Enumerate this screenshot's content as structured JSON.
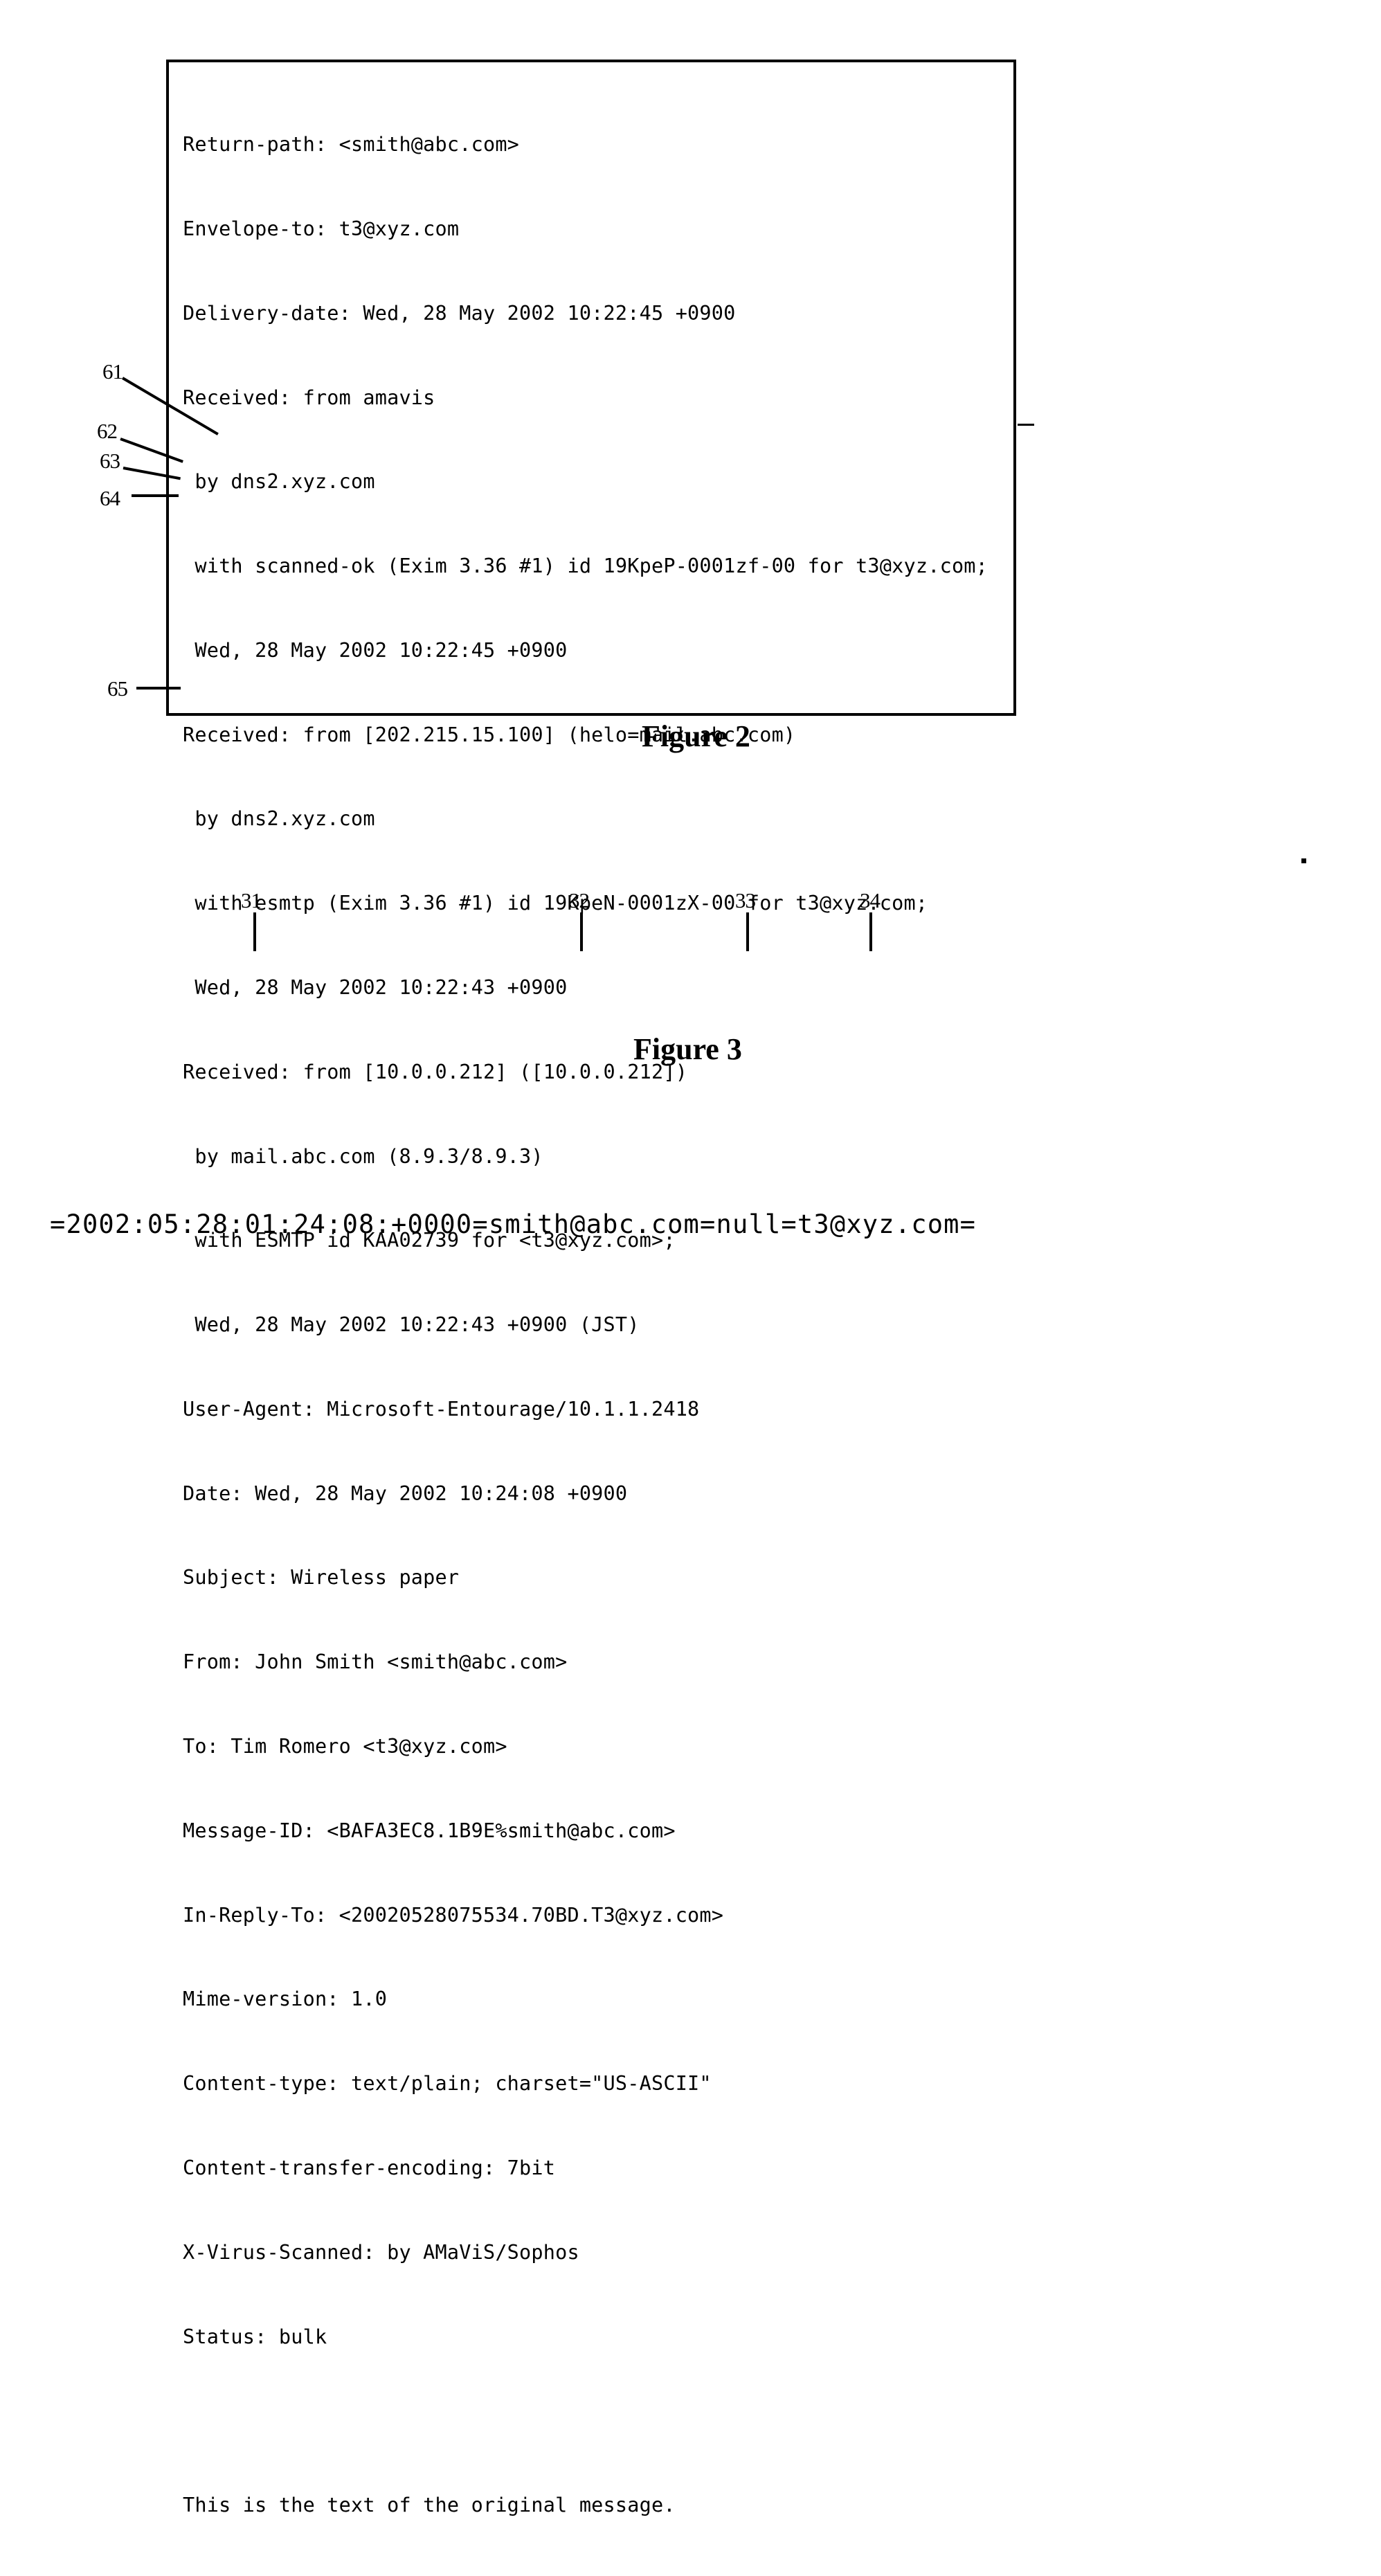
{
  "document": {
    "type": "patent-figure-sheet",
    "figures": [
      {
        "id": "figure-2",
        "caption": "Figure 2",
        "content_type": "email-message-headers",
        "lines": [
          "Return-path: <smith@abc.com>",
          "Envelope-to: t3@xyz.com",
          "Delivery-date: Wed, 28 May 2002 10:22:45 +0900",
          "Received: from amavis",
          " by dns2.xyz.com",
          " with scanned-ok (Exim 3.36 #1) id 19KpeP-0001zf-00 for t3@xyz.com;",
          " Wed, 28 May 2002 10:22:45 +0900",
          "Received: from [202.215.15.100] (helo=mail.abc.com)",
          " by dns2.xyz.com",
          " with esmtp (Exim 3.36 #1) id 19KpeN-0001zX-00 for t3@xyz.com;",
          " Wed, 28 May 2002 10:22:43 +0900",
          "Received: from [10.0.0.212] ([10.0.0.212])",
          " by mail.abc.com (8.9.3/8.9.3)",
          " with ESMTP id KAA02739 for <t3@xyz.com>;",
          " Wed, 28 May 2002 10:22:43 +0900 (JST)",
          "User-Agent: Microsoft-Entourage/10.1.1.2418",
          "Date: Wed, 28 May 2002 10:24:08 +0900",
          "Subject: Wireless paper",
          "From: John Smith <smith@abc.com>",
          "To: Tim Romero <t3@xyz.com>",
          "Message-ID: <BAFA3EC8.1B9E%smith@abc.com>",
          "In-Reply-To: <20020528075534.70BD.T3@xyz.com>",
          "Mime-version: 1.0",
          "Content-type: text/plain; charset=\"US-ASCII\"",
          "Content-transfer-encoding: 7bit",
          "X-Virus-Scanned: by AMaViS/Sophos",
          "Status: bulk",
          "",
          "This is the text of the original message."
        ],
        "callouts": [
          {
            "label": "61",
            "target": "Date: Wed, 28 May 2002 10:24:08 +0900"
          },
          {
            "label": "62",
            "target": "Subject: Wireless paper"
          },
          {
            "label": "63",
            "target": "From: John Smith <smith@abc.com>"
          },
          {
            "label": "64",
            "target": "To: Tim Romero <t3@xyz.com>"
          },
          {
            "label": "65",
            "target": "This is the text of the original message."
          }
        ]
      },
      {
        "id": "figure-3",
        "caption": "Figure 3",
        "content_type": "encoded-identifier-string",
        "encoded_string": "=2002:05:28:01:24:08:+0000=smith@abc.com=null=t3@xyz.com=",
        "callouts": [
          {
            "label": "31",
            "target": "2002:05:28:01:24:08:+0000"
          },
          {
            "label": "32",
            "target": "smith@abc.com"
          },
          {
            "label": "33",
            "target": "null"
          },
          {
            "label": "34",
            "target": "t3@xyz.com"
          }
        ]
      }
    ]
  },
  "colors": {
    "ink": "#000000",
    "page": "#ffffff"
  }
}
